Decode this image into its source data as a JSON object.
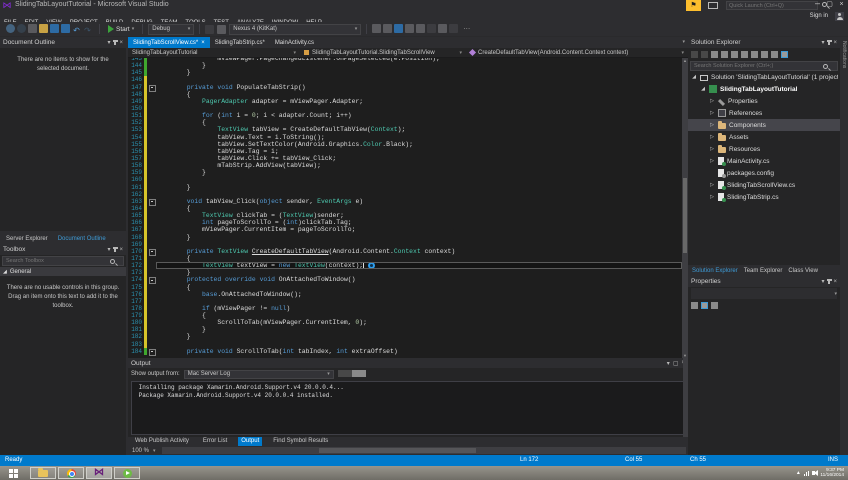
{
  "window": {
    "title": "SlidingTabLayoutTutorial - Microsoft Visual Studio"
  },
  "titlebar": {
    "quick_launch_placeholder": "Quick Launch (Ctrl+Q)",
    "sign_in": "Sign in"
  },
  "menubar": {
    "items": [
      "FILE",
      "EDIT",
      "VIEW",
      "PROJECT",
      "BUILD",
      "DEBUG",
      "TEAM",
      "TOOLS",
      "TEST",
      "ANALYZE",
      "WINDOW",
      "HELP"
    ]
  },
  "toolbar": {
    "start_label": "Start",
    "config_label": "Debug",
    "device_label": "Nexus 4 (KitKat)",
    "left_icons": [
      "navigate-backward-icon",
      "navigate-forward-icon",
      "new-project-icon",
      "open-file-icon",
      "save-icon",
      "save-all-icon",
      "undo-icon",
      "redo-icon"
    ],
    "right_icons": [
      "find-in-files-icon",
      "comment-icon",
      "sdk-manager-icon",
      "device-log-icon",
      "emulator-manager-icon",
      "bookmark-icon",
      "navigate-icon",
      "options-icon"
    ]
  },
  "doc_outline": {
    "title": "Document Outline",
    "empty_text": "There are no items to show for the selected document."
  },
  "left_tabs": [
    {
      "label": "Server Explorer",
      "active": false
    },
    {
      "label": "Document Outline",
      "active": true
    }
  ],
  "toolbox": {
    "title": "Toolbox",
    "search_placeholder": "Search Toolbox",
    "section": "General",
    "empty_text": "There are no usable controls in this group. Drag an item onto this text to add it to the toolbox."
  },
  "editor": {
    "tabs": [
      {
        "label": "SlidingTabScrollView.cs*",
        "active": true
      },
      {
        "label": "SlidingTabStrip.cs*",
        "active": false
      },
      {
        "label": "MainActivity.cs",
        "active": false
      }
    ],
    "breadcrumb": {
      "project": "SlidingTabLayoutTutorial",
      "type": "SlidingTabLayoutTutorial.SlidingTabScrollView",
      "member": "CreateDefaultTabView(Android.Content.Context context)"
    },
    "zoom_level": "100 %",
    "lines": [
      {
        "n": 143,
        "g": "g",
        "t": [
          [
            "p",
            "                mViewPager.PageChangedListener.OnPageSelected(e.Position);"
          ]
        ]
      },
      {
        "n": 144,
        "g": "g",
        "t": [
          [
            "p",
            "            }"
          ]
        ]
      },
      {
        "n": 145,
        "g": "g",
        "t": [
          [
            "p",
            "        }"
          ]
        ]
      },
      {
        "n": 146,
        "g": "y",
        "t": []
      },
      {
        "n": 147,
        "g": "y",
        "box": true,
        "t": [
          [
            "p",
            "        "
          ],
          [
            "k",
            "private"
          ],
          [
            "p",
            " "
          ],
          [
            "k",
            "void"
          ],
          [
            "p",
            " "
          ],
          [
            "p",
            "PopulateTabStrip"
          ],
          [
            "p",
            "()"
          ]
        ]
      },
      {
        "n": 148,
        "g": "y",
        "t": [
          [
            "p",
            "        {"
          ]
        ]
      },
      {
        "n": 149,
        "g": "y",
        "t": [
          [
            "p",
            "            "
          ],
          [
            "t",
            "PagerAdapter"
          ],
          [
            "p",
            " adapter = mViewPager.Adapter;"
          ]
        ]
      },
      {
        "n": 150,
        "g": "y",
        "t": []
      },
      {
        "n": 151,
        "g": "y",
        "t": [
          [
            "p",
            "            "
          ],
          [
            "k",
            "for"
          ],
          [
            "p",
            " ("
          ],
          [
            "k",
            "int"
          ],
          [
            "p",
            " i = "
          ],
          [
            "n",
            "0"
          ],
          [
            "p",
            "; i < adapter.Count; i++)"
          ]
        ]
      },
      {
        "n": 152,
        "g": "y",
        "t": [
          [
            "p",
            "            {"
          ]
        ]
      },
      {
        "n": 153,
        "g": "y",
        "t": [
          [
            "p",
            "                "
          ],
          [
            "t",
            "TextView"
          ],
          [
            "p",
            " tabView = CreateDefaultTabView("
          ],
          [
            "t",
            "Context"
          ],
          [
            "p",
            ");"
          ]
        ]
      },
      {
        "n": 154,
        "g": "y",
        "t": [
          [
            "p",
            "                tabView.Text = i.ToString();"
          ]
        ]
      },
      {
        "n": 155,
        "g": "y",
        "t": [
          [
            "p",
            "                tabView.SetTextColor(Android.Graphics."
          ],
          [
            "t",
            "Color"
          ],
          [
            "p",
            ".Black);"
          ]
        ]
      },
      {
        "n": 156,
        "g": "y",
        "t": [
          [
            "p",
            "                tabView.Tag = i;"
          ]
        ]
      },
      {
        "n": 157,
        "g": "y",
        "t": [
          [
            "p",
            "                tabView.Click += tabView_Click;"
          ]
        ]
      },
      {
        "n": 158,
        "g": "y",
        "t": [
          [
            "p",
            "                mTabStrip.AddView(tabView);"
          ]
        ]
      },
      {
        "n": 159,
        "g": "y",
        "t": [
          [
            "p",
            "            }"
          ]
        ]
      },
      {
        "n": 160,
        "g": "y",
        "t": []
      },
      {
        "n": 161,
        "g": "y",
        "t": [
          [
            "p",
            "        }"
          ]
        ]
      },
      {
        "n": 162,
        "g": "y",
        "t": []
      },
      {
        "n": 163,
        "g": "y",
        "box": true,
        "t": [
          [
            "p",
            "        "
          ],
          [
            "k",
            "void"
          ],
          [
            "p",
            " "
          ],
          [
            "p",
            "tabView_Click"
          ],
          [
            "p",
            "("
          ],
          [
            "k",
            "object"
          ],
          [
            "p",
            " sender, "
          ],
          [
            "t",
            "EventArgs"
          ],
          [
            "p",
            " e)"
          ]
        ]
      },
      {
        "n": 164,
        "g": "y",
        "t": [
          [
            "p",
            "        {"
          ]
        ]
      },
      {
        "n": 165,
        "g": "y",
        "t": [
          [
            "p",
            "            "
          ],
          [
            "t",
            "TextView"
          ],
          [
            "p",
            " clickTab = ("
          ],
          [
            "t",
            "TextView"
          ],
          [
            "p",
            ")sender;"
          ]
        ]
      },
      {
        "n": 166,
        "g": "y",
        "t": [
          [
            "p",
            "            "
          ],
          [
            "k",
            "int"
          ],
          [
            "p",
            " pageToScrollTo = ("
          ],
          [
            "k",
            "int"
          ],
          [
            "p",
            ")clickTab.Tag;"
          ]
        ]
      },
      {
        "n": 167,
        "g": "y",
        "t": [
          [
            "p",
            "            mViewPager.CurrentItem = pageToScrollTo;"
          ]
        ]
      },
      {
        "n": 168,
        "g": "y",
        "t": [
          [
            "p",
            "        }"
          ]
        ]
      },
      {
        "n": 169,
        "g": "y",
        "t": []
      },
      {
        "n": 170,
        "g": "y",
        "box": true,
        "t": [
          [
            "p",
            "        "
          ],
          [
            "k",
            "private"
          ],
          [
            "p",
            " "
          ],
          [
            "t",
            "TextView"
          ],
          [
            "p",
            " "
          ],
          [
            "u",
            "CreateDefaultTabView"
          ],
          [
            "p",
            "(Android.Content."
          ],
          [
            "t",
            "Context"
          ],
          [
            "p",
            " context)"
          ]
        ]
      },
      {
        "n": 171,
        "g": "y",
        "t": [
          [
            "p",
            "        {"
          ]
        ]
      },
      {
        "n": 172,
        "g": "y",
        "cur": true,
        "cursor": true,
        "t": [
          [
            "p",
            "            "
          ],
          [
            "t",
            "TextView"
          ],
          [
            "p",
            " textView = "
          ],
          [
            "k",
            "new"
          ],
          [
            "p",
            " "
          ],
          [
            "t",
            "TextView"
          ],
          [
            "p",
            "(context);"
          ]
        ]
      },
      {
        "n": 173,
        "g": "y",
        "t": [
          [
            "p",
            "        }"
          ]
        ]
      },
      {
        "n": 174,
        "g": "y",
        "box": true,
        "t": [
          [
            "p",
            "        "
          ],
          [
            "k",
            "protected"
          ],
          [
            "p",
            " "
          ],
          [
            "k",
            "override"
          ],
          [
            "p",
            " "
          ],
          [
            "k",
            "void"
          ],
          [
            "p",
            " "
          ],
          [
            "p",
            "OnAttachedToWindow"
          ],
          [
            "p",
            "()"
          ]
        ]
      },
      {
        "n": 175,
        "g": "y",
        "t": [
          [
            "p",
            "        {"
          ]
        ]
      },
      {
        "n": 176,
        "g": "y",
        "t": [
          [
            "p",
            "            "
          ],
          [
            "k",
            "base"
          ],
          [
            "p",
            ".OnAttachedToWindow();"
          ]
        ]
      },
      {
        "n": 177,
        "g": "y",
        "t": []
      },
      {
        "n": 178,
        "g": "y",
        "t": [
          [
            "p",
            "            "
          ],
          [
            "k",
            "if"
          ],
          [
            "p",
            " (mViewPager != "
          ],
          [
            "k",
            "null"
          ],
          [
            "p",
            ")"
          ]
        ]
      },
      {
        "n": 179,
        "g": "y",
        "t": [
          [
            "p",
            "            {"
          ]
        ]
      },
      {
        "n": 180,
        "g": "y",
        "t": [
          [
            "p",
            "                ScrollToTab(mViewPager.CurrentItem, "
          ],
          [
            "n",
            "0"
          ],
          [
            "p",
            ");"
          ]
        ]
      },
      {
        "n": 181,
        "g": "y",
        "t": [
          [
            "p",
            "            }"
          ]
        ]
      },
      {
        "n": 182,
        "g": "y",
        "t": [
          [
            "p",
            "        }"
          ]
        ]
      },
      {
        "n": 183,
        "g": "y",
        "t": []
      },
      {
        "n": 184,
        "g": "g",
        "box": true,
        "t": [
          [
            "p",
            "        "
          ],
          [
            "k",
            "private"
          ],
          [
            "p",
            " "
          ],
          [
            "k",
            "void"
          ],
          [
            "p",
            " "
          ],
          [
            "p",
            "ScrollToTab"
          ],
          [
            "p",
            "("
          ],
          [
            "k",
            "int"
          ],
          [
            "p",
            " tabIndex, "
          ],
          [
            "k",
            "int"
          ],
          [
            "p",
            " extraOffset)"
          ]
        ]
      }
    ]
  },
  "output": {
    "title": "Output",
    "show_from": "Show output from:",
    "source": "Mac Server Log",
    "toolbar_icons": [
      "find-icon",
      "find-next-icon",
      "clear-all-icon",
      "toggle-word-wrap-icon"
    ],
    "lines": [
      "Installing package Xamarin.Android.Support.v4 20.0.0.4...",
      "Package Xamarin.Android.Support.v4 20.0.0.4 installed."
    ]
  },
  "bottom_tabs": [
    {
      "label": "Web Publish Activity",
      "active": false
    },
    {
      "label": "Error List",
      "active": false
    },
    {
      "label": "Output",
      "active": true
    },
    {
      "label": "Find Symbol Results",
      "active": false
    }
  ],
  "solution_explorer": {
    "title": "Solution Explorer",
    "search_placeholder": "Search Solution Explorer (Ctrl+;)",
    "toolbar_icons": [
      "back-icon",
      "forward-icon",
      "home-icon",
      "collapse-all-icon",
      "filter-icon",
      "sync-with-active-document-icon",
      "refresh-icon",
      "show-all-files-icon",
      "properties-icon",
      "preview-selected-items-icon"
    ],
    "items": [
      {
        "label": "Solution 'SlidingTabLayoutTutorial' (1 project)",
        "icon": "solution",
        "indent": 0,
        "arrow": "down"
      },
      {
        "label": "SlidingTabLayoutTutorial",
        "icon": "csproject",
        "indent": 1,
        "arrow": "down",
        "bold": true
      },
      {
        "label": "Properties",
        "icon": "properties",
        "indent": 2,
        "arrow": "right"
      },
      {
        "label": "References",
        "icon": "references",
        "indent": 2,
        "arrow": "right"
      },
      {
        "label": "Components",
        "icon": "folder",
        "indent": 2,
        "arrow": "right",
        "selected": true
      },
      {
        "label": "Assets",
        "icon": "folder",
        "indent": 2,
        "arrow": "right"
      },
      {
        "label": "Resources",
        "icon": "folder",
        "indent": 2,
        "arrow": "right"
      },
      {
        "label": "MainActivity.cs",
        "icon": "cs",
        "indent": 2,
        "arrow": "right"
      },
      {
        "label": "packages.config",
        "icon": "config",
        "indent": 2,
        "arrow": "none"
      },
      {
        "label": "SlidingTabScrollView.cs",
        "icon": "cs",
        "indent": 2,
        "arrow": "right"
      },
      {
        "label": "SlidingTabStrip.cs",
        "icon": "cs",
        "indent": 2,
        "arrow": "right"
      }
    ]
  },
  "right_tabs": [
    {
      "label": "Solution Explorer",
      "active": true
    },
    {
      "label": "Team Explorer",
      "active": false
    },
    {
      "label": "Class View",
      "active": false
    }
  ],
  "properties": {
    "title": "Properties",
    "toolbar_icons": [
      "categorized-icon",
      "alphabetical-icon",
      "property-pages-icon"
    ]
  },
  "notifications_label": "Notifications",
  "statusbar": {
    "state": "Ready",
    "ln": "Ln 172",
    "col": "Col 55",
    "ch": "Ch 55",
    "ins": "INS"
  },
  "taskbar": {
    "time": "9:37 PM",
    "date": "11/16/2014"
  },
  "colors": {
    "accent": "#007ACC",
    "keyword": "#569CD6",
    "type": "#4EC9B0",
    "line_number": "#2B91AF",
    "modified_unsaved": "#D6C42A",
    "modified_saved": "#3FA72E",
    "flag": "#FDBE2D",
    "vs_purple": "#68217A"
  }
}
